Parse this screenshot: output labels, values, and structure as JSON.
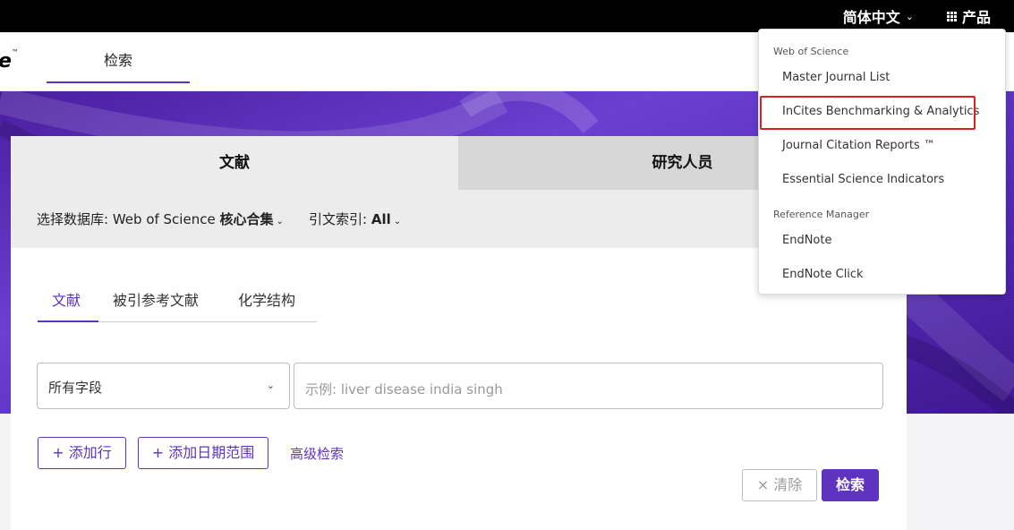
{
  "topbar": {
    "language": "简体中文",
    "products": "产品"
  },
  "navbar": {
    "brand_fragment": "e",
    "brand_tm": "™",
    "search_tab": "检索"
  },
  "search_card": {
    "tabs": [
      "文献",
      "研究人员"
    ],
    "database_label": "选择数据库:",
    "database_value": "Web of Science",
    "database_value_bold": "核心合集",
    "citation_label": "引文索引:",
    "citation_value": "All",
    "subtabs": [
      "文献",
      "被引参考文献",
      "化学结构"
    ],
    "field_select": "所有字段",
    "query_placeholder": "示例: liver disease india singh",
    "add_row": "添加行",
    "add_date": "添加日期范围",
    "advanced": "高级检索",
    "clear": "清除",
    "search": "检索"
  },
  "products_menu": {
    "sections": [
      {
        "header": "Web of Science",
        "items": [
          "Master Journal List",
          "InCites Benchmarking & Analytics",
          "Journal Citation Reports ™",
          "Essential Science Indicators"
        ]
      },
      {
        "header": "Reference Manager",
        "items": [
          "EndNote",
          "EndNote Click"
        ]
      }
    ],
    "highlighted_item": "InCites Benchmarking & Analytics"
  },
  "colors": {
    "accent": "#5e33bf",
    "highlight_box": "#e01e1e",
    "topbar": "#000000"
  },
  "icons": [
    "chevron-down-icon",
    "grid-icon",
    "plus-icon",
    "close-icon"
  ]
}
